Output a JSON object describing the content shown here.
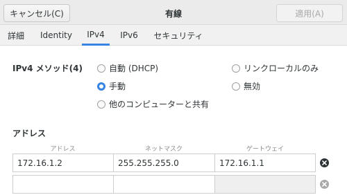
{
  "header": {
    "cancel_label": "キャンセル(C)",
    "title": "有線",
    "apply_label": "適用(A)"
  },
  "tabs": [
    {
      "label": "詳細"
    },
    {
      "label": "Identity"
    },
    {
      "label": "IPv4"
    },
    {
      "label": "IPv6"
    },
    {
      "label": "セキュリティ"
    }
  ],
  "active_tab": "IPv4",
  "ipv4": {
    "method_label": "IPv4 メソッド(4)",
    "methods": [
      {
        "label": "自動 (DHCP)",
        "selected": false
      },
      {
        "label": "手動",
        "selected": true
      },
      {
        "label": "他のコンピューターと共有",
        "selected": false
      },
      {
        "label": "リンクローカルのみ",
        "selected": false
      },
      {
        "label": "無効",
        "selected": false
      }
    ]
  },
  "address": {
    "section_label": "アドレス",
    "columns": [
      "アドレス",
      "ネットマスク",
      "ゲートウェイ"
    ],
    "rows": [
      [
        "172.16.1.2",
        "255.255.255.0",
        "172.16.1.1"
      ],
      [
        "",
        "",
        ""
      ]
    ]
  },
  "colors": {
    "accent": "#3584e4",
    "header_bg": "#ebebeb",
    "text": "#2e3436"
  }
}
